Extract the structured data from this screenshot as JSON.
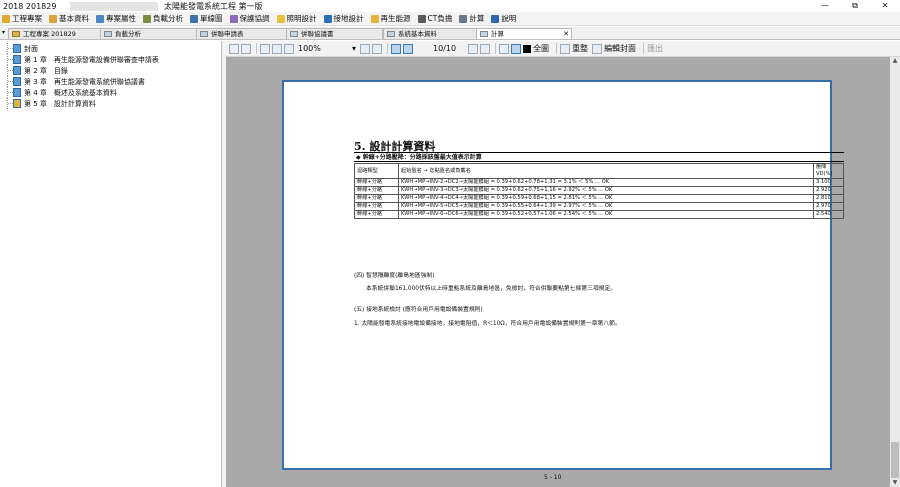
{
  "window": {
    "app_title": "2018 201829",
    "doc_title": "太陽能發電系統工程 第一版",
    "buttons": {
      "minimize": "—",
      "restore": "⧉",
      "close": "✕"
    }
  },
  "menu": {
    "items": [
      {
        "label": "工程專案",
        "icon": "folder-icon",
        "color": "#e0a72e"
      },
      {
        "label": "基本資料",
        "icon": "data-icon",
        "color": "#d7a43a"
      },
      {
        "label": "專案屬性",
        "icon": "properties-icon",
        "color": "#4f86c6"
      },
      {
        "label": "負載分析",
        "icon": "analysis-icon",
        "color": "#7a8e3f"
      },
      {
        "label": "單線圖",
        "icon": "diagram-icon",
        "color": "#3f6fb0"
      },
      {
        "label": "保護協調",
        "icon": "protection-icon",
        "color": "#8e6bb8"
      },
      {
        "label": "照明設計",
        "icon": "lighting-icon",
        "color": "#e8c33a"
      },
      {
        "label": "接地設計",
        "icon": "grounding-icon",
        "color": "#2d6fb0"
      },
      {
        "label": "再生能源",
        "icon": "renewable-icon",
        "color": "#e2b23b"
      },
      {
        "label": "CT負擔",
        "icon": "ct-icon",
        "color": "#5a5a5a"
      },
      {
        "label": "計算",
        "icon": "calculator-icon",
        "color": "#6a7a8a"
      },
      {
        "label": "說明",
        "icon": "help-icon",
        "color": "#2d66b5"
      }
    ]
  },
  "tabs": [
    {
      "label": "工程專案 201829",
      "active": false
    },
    {
      "label": "負載分析",
      "active": false
    },
    {
      "label": "併聯申請表",
      "active": false
    },
    {
      "label": "併聯協議書",
      "active": false
    },
    {
      "label": "系統基本資料",
      "active": false
    },
    {
      "label": "計算",
      "active": true
    }
  ],
  "tree": {
    "items": [
      {
        "label": "封面",
        "color": "#5b9bd5"
      },
      {
        "label": "第 1 章　再生能源發電設備併聯審查申請表",
        "color": "#5b9bd5"
      },
      {
        "label": "第 2 章　目錄",
        "color": "#5b9bd5"
      },
      {
        "label": "第 3 章　再生能源發電系統併聯協議書",
        "color": "#5b9bd5"
      },
      {
        "label": "第 4 章　概述及系統基本資料",
        "color": "#5b9bd5"
      },
      {
        "label": "第 5 章　設計計算資料",
        "color": "#e5b53b"
      }
    ]
  },
  "viewer_toolbar": {
    "zoom": "100%",
    "page_indicator": "10/10",
    "fit_all": "全圖",
    "refresh": "重整",
    "edit_cover": "編輯封面",
    "exit": "匯出"
  },
  "document": {
    "section_title": "5. 設計計算資料",
    "table_title": "◆ 幹線+分路壓降：分路採該盤最大值表示計算",
    "columns": [
      "迴路類型",
      "起始盤名 → 迄點盤名或負載名",
      "壓降 VD(%)"
    ],
    "rows": [
      {
        "type": "幹線+分路",
        "path": "KWH→MP→INV-2→DC2→太陽能模組 = 0.39+0.62+0.78+1.31 = 3.1% ＜ 5% ... OK",
        "vd": "3.100"
      },
      {
        "type": "幹線+分路",
        "path": "KWH→MP→INV-3→DC3→太陽能模組 = 0.39+0.62+0.75+1.16 = 2.92% ＜ 5% ... OK",
        "vd": "2.920"
      },
      {
        "type": "幹線+分路",
        "path": "KWH→MP→INV-4→DC4→太陽能模組 = 0.39+0.59+0.68+1.15 = 2.81% ＜ 5% ... OK",
        "vd": "2.810"
      },
      {
        "type": "幹線+分路",
        "path": "KWH→MP→INV-5→DC5→太陽能模組 = 0.39+0.55+0.64+1.39 = 2.97% ＜ 5% ... OK",
        "vd": "2.970"
      },
      {
        "type": "幹線+分路",
        "path": "KWH→MP→INV-6→DC6→太陽能模組 = 0.39+0.52+0.57+1.06 = 2.54% ＜ 5% ... OK",
        "vd": "2.540"
      }
    ],
    "para1_heading": "(四) 智慧隔離度(離島地區強制)",
    "para1_body": "本系統併聯161,000伏特以上時重點系統及離島地區，免檢討，符合併聯要點第七條第三項規定。",
    "para2_heading": "(五) 接地系統檢討 (應符合用戶用電設備裝置規則)",
    "para2_body": "1. 太陽能發電系統接地電設備接地，接地電阻值，R＜10Ω，符合用戶用電設備裝置規則第一章第八節。",
    "page_number": "5 - 10"
  }
}
